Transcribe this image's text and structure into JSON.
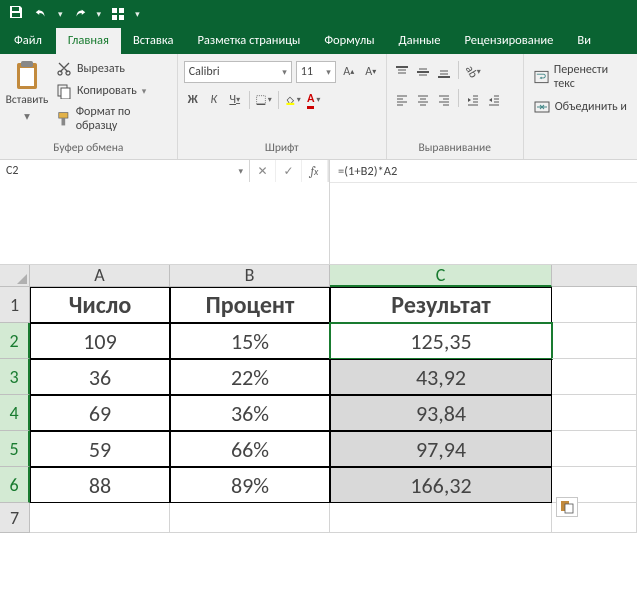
{
  "tabs": {
    "file": "Файл",
    "home": "Главная",
    "insert": "Вставка",
    "layout": "Разметка страницы",
    "formulas": "Формулы",
    "data": "Данные",
    "review": "Рецензирование",
    "view": "Ви"
  },
  "ribbon": {
    "clipboard": {
      "paste": "Вставить",
      "cut": "Вырезать",
      "copy": "Копировать",
      "format_painter": "Формат по образцу",
      "label": "Буфер обмена"
    },
    "font": {
      "name": "Calibri",
      "size": "11",
      "label": "Шрифт"
    },
    "align": {
      "label": "Выравнивание",
      "wrap": "Перенести текс",
      "merge": "Объединить и"
    }
  },
  "name_box": "C2",
  "formula": "=(1+B2)*A2",
  "grid": {
    "cols": [
      "A",
      "B",
      "C"
    ],
    "headers": [
      "Число",
      "Процент",
      "Результат"
    ],
    "rows": [
      {
        "n": "1"
      },
      {
        "n": "2",
        "a": "109",
        "b": "15%",
        "c": "125,35"
      },
      {
        "n": "3",
        "a": "36",
        "b": "22%",
        "c": "43,92"
      },
      {
        "n": "4",
        "a": "69",
        "b": "36%",
        "c": "93,84"
      },
      {
        "n": "5",
        "a": "59",
        "b": "66%",
        "c": "97,94"
      },
      {
        "n": "6",
        "a": "88",
        "b": "89%",
        "c": "166,32"
      },
      {
        "n": "7"
      }
    ]
  }
}
